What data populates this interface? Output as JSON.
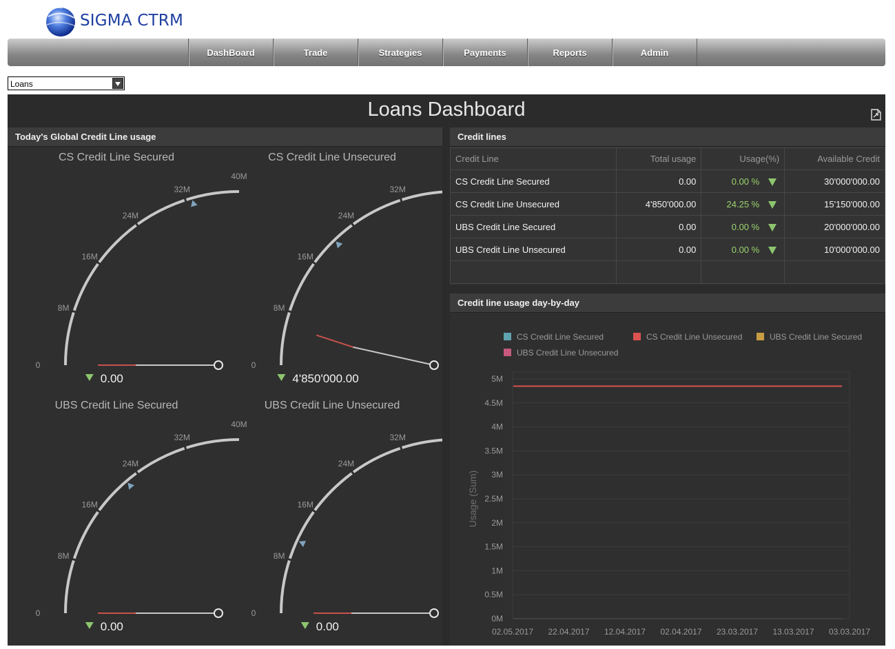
{
  "app": {
    "logo_text": "SIGMA CTRM",
    "nav": [
      "DashBoard",
      "Trade",
      "Strategies",
      "Payments",
      "Reports",
      "Admin"
    ],
    "selector_value": "Loans"
  },
  "colors": {
    "gauge_arc": "#c8c8c8",
    "gauge_needle_red": "#c8524b",
    "gauge_needle_grey": "#c8c8c8",
    "gauge_marker": "#7fa3bd",
    "trend_green": "#8dc56e",
    "series_cs_secured": "#5fa3b0",
    "series_cs_unsecured": "#d9534f",
    "series_ubs_secured": "#c89c43",
    "series_ubs_unsecured": "#c75a7c"
  },
  "dashboard": {
    "title": "Loans Dashboard",
    "export_icon": "export-icon"
  },
  "gauges_panel": {
    "title": "Today's Global Credit Line usage",
    "scale_labels": [
      "0",
      "8M",
      "16M",
      "24M",
      "32M",
      "40M"
    ],
    "scale_max": 40000000,
    "gauges": [
      {
        "title": "CS Credit Line Secured",
        "value": 0,
        "value_text": "0.00",
        "marker": 33000000
      },
      {
        "title": "CS Credit Line Unsecured",
        "value": 4850000,
        "value_text": "4'850'000.00",
        "marker": 20500000
      },
      {
        "title": "UBS Credit Line Secured",
        "value": 0,
        "value_text": "0.00",
        "marker": 22000000
      },
      {
        "title": "UBS Credit Line Unsecured",
        "value": 0,
        "value_text": "0.00",
        "marker": 11000000
      }
    ]
  },
  "credit_lines": {
    "title": "Credit lines",
    "columns": [
      "Credit Line",
      "Total usage",
      "Usage(%)",
      "Available Credit"
    ],
    "rows": [
      {
        "name": "CS Credit Line Secured",
        "total": "0.00",
        "pct": "0.00 %",
        "available": "30'000'000.00"
      },
      {
        "name": "CS Credit Line Unsecured",
        "total": "4'850'000.00",
        "pct": "24.25 %",
        "available": "15'150'000.00"
      },
      {
        "name": "UBS Credit Line Secured",
        "total": "0.00",
        "pct": "0.00 %",
        "available": "20'000'000.00"
      },
      {
        "name": "UBS Credit Line Unsecured",
        "total": "0.00",
        "pct": "0.00 %",
        "available": "10'000'000.00"
      }
    ]
  },
  "usage_chart": {
    "title": "Credit line usage day-by-day"
  },
  "chart_data": {
    "type": "line",
    "title": "Credit line usage day-by-day",
    "ylabel": "Usage (Sum)",
    "xlabel": "",
    "ylim": [
      0,
      5000000
    ],
    "y_tick_labels": [
      "0M",
      "0.5M",
      "1M",
      "1.5M",
      "2M",
      "2.5M",
      "3M",
      "3.5M",
      "4M",
      "4.5M",
      "5M"
    ],
    "x_tick_labels": [
      "02.05.2017",
      "22.04.2017",
      "12.04.2017",
      "02.04.2017",
      "23.03.2017",
      "13.03.2017",
      "03.03.2017"
    ],
    "x_domain": [
      "02.05.2017",
      "03.03.2017"
    ],
    "grid": true,
    "legend_position": "top",
    "series": [
      {
        "name": "CS Credit Line Secured",
        "values": [
          0,
          0
        ]
      },
      {
        "name": "CS Credit Line Unsecured",
        "values": [
          4850000,
          4850000
        ]
      },
      {
        "name": "UBS Credit Line Secured",
        "values": [
          0,
          0
        ]
      },
      {
        "name": "UBS Credit Line Unsecured",
        "values": [
          0,
          0
        ]
      }
    ]
  }
}
